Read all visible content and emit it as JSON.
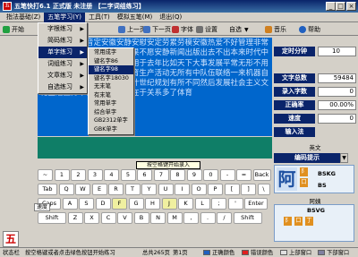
{
  "window": {
    "app_icon": "五",
    "title": "五笔快打6.1 正式版 未注册 【二字词组练习】",
    "controls": [
      "_",
      "□",
      "×"
    ]
  },
  "menubar": [
    "指法基础(Z)",
    "五笔学习(Y)",
    "工具(T)",
    "模拟五笔(M)",
    "退出(Q)"
  ],
  "toolbar": {
    "start": "开始",
    "prev_page": "上一页",
    "next_page": "下一页",
    "font": "字体",
    "settings": "设置",
    "custom": "自选",
    "music": "音乐",
    "help": "帮助"
  },
  "menu_level1": {
    "items": [
      "字根练习",
      "简码练习",
      "单字练习",
      "词组练习",
      "文章练习",
      "自选练习"
    ],
    "selected_index": 2
  },
  "menu_level2": {
    "items": [
      "字根练习",
      "简码练习",
      "单字练习",
      "词组练习",
      "文章练习",
      "自选练习"
    ],
    "selected_index": 2
  },
  "menu_level3": {
    "items": [
      "常用成字",
      "键名字86",
      "键名字98",
      "键名字18030",
      "无末笔",
      "有末笔",
      "常用单字",
      "综合单字",
      "GB2312单字",
      "GBK单字"
    ],
    "selected_index": 2
  },
  "practice_text": "宣传教育爱情音定安徽安静安慰安定劳累劳模安徽热爱不好管理非常安静方向热爱尊重日问卷如果不愿安静新闻出版出去不出本来时代中国日中国中共加盟中心生成用于去年比如天下大事发展平常无形不用规划方面的中国共产文化教育生产活动无所有中队伍联络一来机器自动不是教育世界一次文化设计世纪规划有所不同然后发展社会主义文化生活业务不在实行一不敢在于关系多了体育",
  "hint_popup": "按空格键开始录入",
  "keyboard": {
    "row1": [
      "~",
      "1",
      "2",
      "3",
      "4",
      "5",
      "6",
      "7",
      "8",
      "9",
      "0",
      "-",
      "=",
      "Back"
    ],
    "row2": [
      "Tab",
      "Q",
      "W",
      "E",
      "R",
      "T",
      "Y",
      "U",
      "I",
      "O",
      "P",
      "[",
      "]",
      "\\"
    ],
    "row3": [
      "Caps",
      "A",
      "S",
      "D",
      "F",
      "G",
      "H",
      "J",
      "K",
      "L",
      ";",
      "'",
      "Enter"
    ],
    "row4": [
      "Shift",
      "Z",
      "X",
      "C",
      "V",
      "B",
      "N",
      "M",
      ",",
      ".",
      "/",
      "Shift"
    ],
    "speed_label": "速度",
    "home_keys": [
      "F",
      "J"
    ]
  },
  "stats": {
    "timer_label": "定时分钟",
    "timer_value": "10",
    "total_label": "文字总数",
    "total_value": "59484",
    "entered_label": "录入字数",
    "entered_value": "0",
    "accuracy_label": "正确率",
    "accuracy_value": "00.00%",
    "speed_label": "速度",
    "speed_value": "0",
    "input_method_label": "输入法",
    "input_method_value": "英文"
  },
  "code_hint": {
    "button": "编码提示",
    "arrow": "▼",
    "char1": "阿",
    "tiles1": [
      "阝",
      "口",
      "丁"
    ],
    "code1": "BSKG",
    "code1b": "BS",
    "label2": "阿姨",
    "code2": "BSVG"
  },
  "statusbar": {
    "label": "状态栏",
    "message": "按空格键或者点击绿色按钮开始练习",
    "total_pages": "总共265页",
    "current_page": "第1页",
    "correct_label": "正确颜色",
    "wrong_label": "错误颜色",
    "upper_label": "上部窗口",
    "lower_label": "下部窗口"
  },
  "colors": {
    "title_bg": "#0a246a",
    "text_area_bg": "#0066cc",
    "green_bar": "#0f7e67",
    "label_bg": "#0a246a",
    "correct": "#2060c0",
    "wrong": "#e02020",
    "upper": "#e0e0e0",
    "lower": "#8080a0"
  }
}
